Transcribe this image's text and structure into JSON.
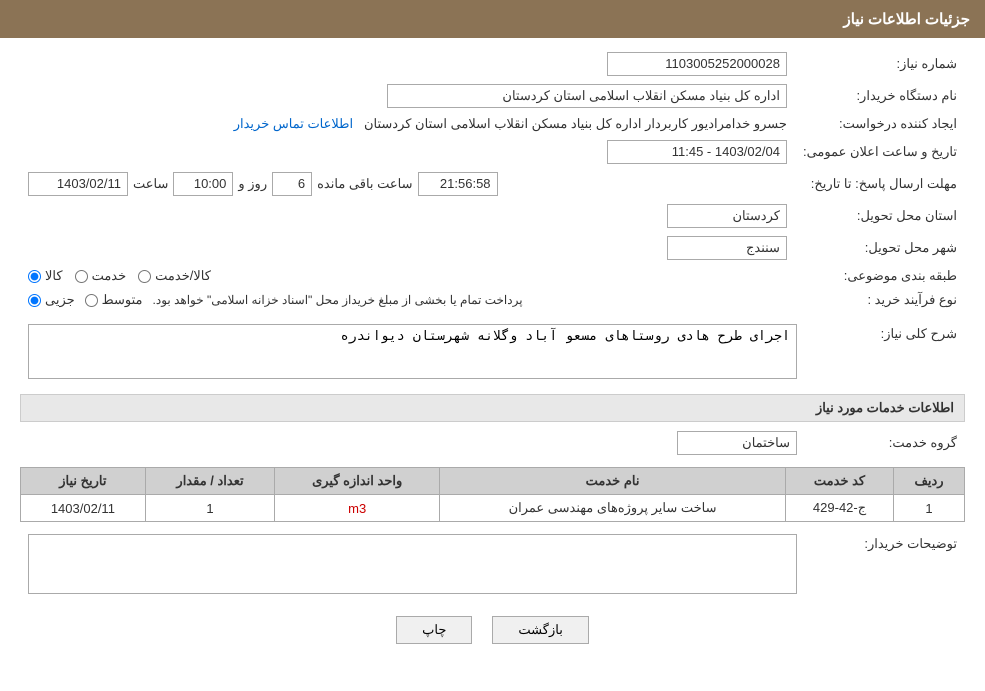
{
  "header": {
    "title": "جزئیات اطلاعات نیاز"
  },
  "fields": {
    "shomare_niaz_label": "شماره نیاز:",
    "shomare_niaz_value": "1103005252000028",
    "nam_dastgah_label": "نام دستگاه خریدار:",
    "nam_dastgah_value": "اداره کل بنیاد مسکن انقلاب اسلامی استان کردستان",
    "ijad_label": "ایجاد کننده درخواست:",
    "ijad_value": "جسرو خدامرادیور کاربردار اداره کل بنیاد مسکن انقلاب اسلامی استان کردستان",
    "ijad_link": "اطلاعات تماس خریدار",
    "tarikh_label": "تاریخ و ساعت اعلان عمومی:",
    "tarikh_value": "1403/02/04 - 11:45",
    "mohlat_label": "مهلت ارسال پاسخ: تا تاریخ:",
    "mohlat_date": "1403/02/11",
    "mohlat_saat_label": "ساعت",
    "mohlat_saat": "10:00",
    "mohlat_roz_label": "روز و",
    "mohlat_roz": "6",
    "mohlat_remaining_label": "ساعت باقی مانده",
    "mohlat_remaining": "21:56:58",
    "ostan_label": "استان محل تحویل:",
    "ostan_value": "کردستان",
    "shahr_label": "شهر محل تحویل:",
    "shahr_value": "سنندج",
    "tabaqe_label": "طبقه بندی موضوعی:",
    "tabaqe_kala": "کالا",
    "tabaqe_khedmat": "خدمت",
    "tabaqe_kala_khedmat": "کالا/خدمت",
    "noue_farayand_label": "نوع فرآیند خرید :",
    "noue_jozyi": "جزیی",
    "noue_motovaset": "متوسط",
    "noue_desc": "پرداخت تمام یا بخشی از مبلغ خریداز محل \"اسناد خزانه اسلامی\" خواهد بود.",
    "sharh_label": "شرح کلی نیاز:",
    "sharh_value": "اجرای طرح هادی روستاهای مسعو آباد وگلانه شهرستان دیواندره",
    "service_info_title": "اطلاعات خدمات مورد نیاز",
    "group_service_label": "گروه خدمت:",
    "group_service_value": "ساختمان",
    "table_headers": {
      "radif": "ردیف",
      "kod_khedmat": "کد خدمت",
      "name_khedmat": "نام خدمت",
      "vahed_andazegiri": "واحد اندازه گیری",
      "tedad_megdar": "تعداد / مقدار",
      "tarikh_niaz": "تاریخ نیاز"
    },
    "table_rows": [
      {
        "radif": "1",
        "kod_khedmat": "ج-42-429",
        "name_khedmat": "ساخت سایر پروژه‌های مهندسی عمران",
        "vahed_andazegiri": "m3",
        "tedad_megdar": "1",
        "tarikh_niaz": "1403/02/11"
      }
    ],
    "tosifat_label": "توضیحات خریدار:",
    "btn_print": "چاپ",
    "btn_back": "بازگشت"
  }
}
